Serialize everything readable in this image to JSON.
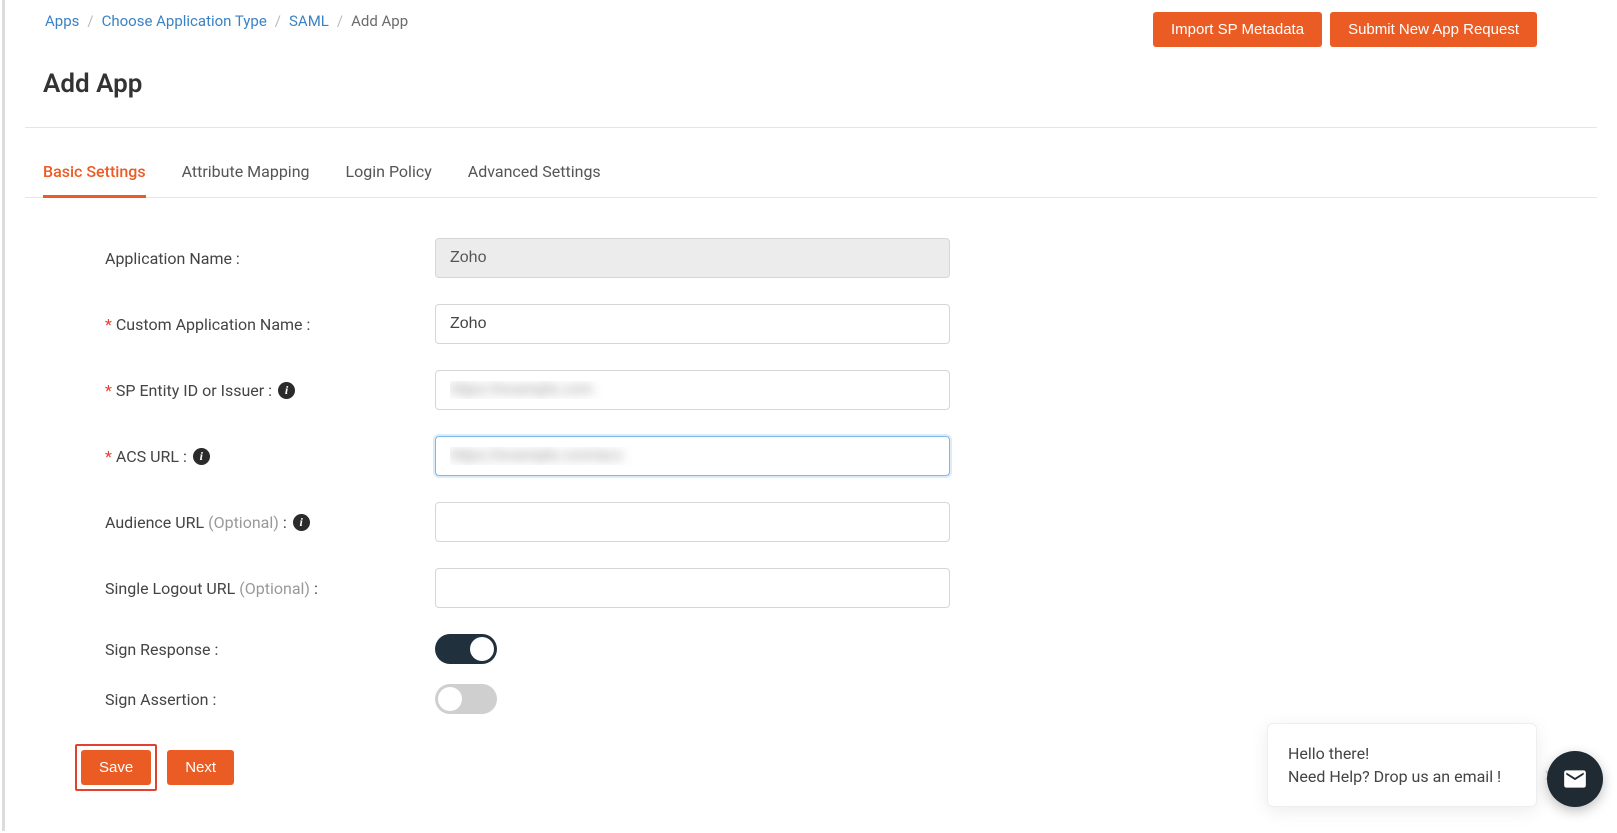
{
  "breadcrumb": {
    "items": [
      "Apps",
      "Choose Application Type",
      "SAML"
    ],
    "current": "Add App"
  },
  "top_buttons": {
    "import": "Import SP Metadata",
    "submit": "Submit New App Request"
  },
  "page_title": "Add App",
  "tabs": [
    {
      "label": "Basic Settings",
      "active": true
    },
    {
      "label": "Attribute Mapping",
      "active": false
    },
    {
      "label": "Login Policy",
      "active": false
    },
    {
      "label": "Advanced Settings",
      "active": false
    }
  ],
  "form": {
    "app_name": {
      "label": "Application Name :",
      "value": "Zoho"
    },
    "custom_name": {
      "label": "Custom Application Name :",
      "value": "Zoho",
      "required": true
    },
    "sp_entity": {
      "label": "SP Entity ID or Issuer :",
      "value": "https://example.com",
      "required": true,
      "info": true
    },
    "acs_url": {
      "label": "ACS URL :",
      "value": "https://example.com/acs",
      "required": true,
      "info": true,
      "focused": true
    },
    "audience_url": {
      "label_main": "Audience URL ",
      "label_opt": "(Optional)",
      "label_suffix": " :",
      "value": "",
      "info": true
    },
    "slo_url": {
      "label_main": "Single Logout URL ",
      "label_opt": "(Optional)",
      "label_suffix": " :",
      "value": ""
    },
    "sign_response": {
      "label": "Sign Response :",
      "on": true
    },
    "sign_assertion": {
      "label": "Sign Assertion :",
      "on": false
    }
  },
  "footer": {
    "save": "Save",
    "next": "Next"
  },
  "chat": {
    "line1": "Hello there!",
    "line2": "Need Help? Drop us an email !"
  }
}
